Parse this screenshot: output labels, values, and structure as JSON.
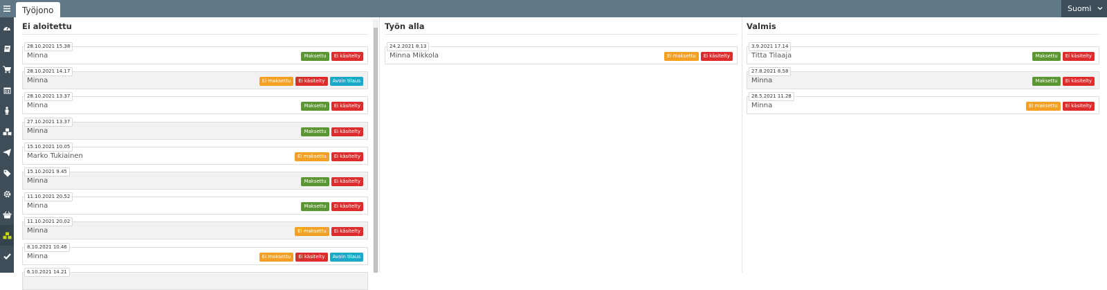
{
  "header": {
    "tab_label": "Työjono",
    "language": "Suomi"
  },
  "sidebar": {
    "items": [
      {
        "icon": "dashboard-icon"
      },
      {
        "icon": "book-icon"
      },
      {
        "icon": "cart-icon"
      },
      {
        "icon": "calendar-icon"
      },
      {
        "icon": "person-icon"
      },
      {
        "icon": "cubes-icon"
      },
      {
        "icon": "paper-plane-icon"
      },
      {
        "icon": "tag-icon"
      },
      {
        "icon": "gear-icon"
      },
      {
        "icon": "basket-icon"
      },
      {
        "icon": "cubes-active-icon",
        "active": true
      },
      {
        "icon": "check-icon"
      }
    ]
  },
  "colors": {
    "topbar": "#5f7989",
    "sidebar": "#3e4d57",
    "active_icon": "#c6d61a",
    "badge_green": "#5c9632",
    "badge_red": "#dd2c2c",
    "badge_orange": "#f4a024",
    "badge_cyan": "#1aa9c9"
  },
  "columns": [
    {
      "title": "Ei aloitettu",
      "cards": [
        {
          "date": "28.10.2021 15.38",
          "name": "Minna",
          "badges": [
            {
              "text": "Maksettu",
              "color": "green"
            },
            {
              "text": "Ei käsitelty",
              "color": "red"
            }
          ]
        },
        {
          "date": "28.10.2021 14.17",
          "name": "Minna",
          "badges": [
            {
              "text": "Ei maksettu",
              "color": "orange"
            },
            {
              "text": "Ei käsitelty",
              "color": "red"
            },
            {
              "text": "Avoin tilaus",
              "color": "cyan"
            }
          ]
        },
        {
          "date": "28.10.2021 13.37",
          "name": "Minna",
          "badges": [
            {
              "text": "Maksettu",
              "color": "green"
            },
            {
              "text": "Ei käsitelty",
              "color": "red"
            }
          ]
        },
        {
          "date": "27.10.2021 13.37",
          "name": "Minna",
          "badges": [
            {
              "text": "Maksettu",
              "color": "green"
            },
            {
              "text": "Ei käsitelty",
              "color": "red"
            }
          ]
        },
        {
          "date": "15.10.2021 10.05",
          "name": "Marko Tukiainen",
          "badges": [
            {
              "text": "Ei maksettu",
              "color": "orange"
            },
            {
              "text": "Ei käsitelty",
              "color": "red"
            }
          ]
        },
        {
          "date": "15.10.2021 9.45",
          "name": "Minna",
          "badges": [
            {
              "text": "Maksettu",
              "color": "green"
            },
            {
              "text": "Ei käsitelty",
              "color": "red"
            }
          ]
        },
        {
          "date": "11.10.2021 20.52",
          "name": "Minna",
          "badges": [
            {
              "text": "Maksettu",
              "color": "green"
            },
            {
              "text": "Ei käsitelty",
              "color": "red"
            }
          ]
        },
        {
          "date": "11.10.2021 20.02",
          "name": "Minna",
          "badges": [
            {
              "text": "Ei maksettu",
              "color": "orange"
            },
            {
              "text": "Ei käsitelty",
              "color": "red"
            }
          ]
        },
        {
          "date": "8.10.2021 10.46",
          "name": "Minna",
          "badges": [
            {
              "text": "Ei maksettu",
              "color": "orange"
            },
            {
              "text": "Ei käsitelty",
              "color": "red"
            },
            {
              "text": "Avoin tilaus",
              "color": "cyan"
            }
          ]
        },
        {
          "date": "6.10.2021 14.21",
          "name": "",
          "badges": []
        }
      ]
    },
    {
      "title": "Työn alla",
      "cards": [
        {
          "date": "24.2.2021 8.13",
          "name": "Minna Mikkola",
          "badges": [
            {
              "text": "Ei maksettu",
              "color": "orange"
            },
            {
              "text": "Ei käsitelty",
              "color": "red"
            }
          ]
        }
      ]
    },
    {
      "title": "Valmis",
      "cards": [
        {
          "date": "3.9.2021 17.14",
          "name": "Titta Tilaaja",
          "badges": [
            {
              "text": "Maksettu",
              "color": "green"
            },
            {
              "text": "Ei käsitelty",
              "color": "red"
            }
          ]
        },
        {
          "date": "27.8.2021 8.58",
          "name": "Minna",
          "badges": [
            {
              "text": "Maksettu",
              "color": "green"
            },
            {
              "text": "Ei käsitelty",
              "color": "red"
            }
          ]
        },
        {
          "date": "28.5.2021 11.28",
          "name": "Minna",
          "badges": [
            {
              "text": "Ei maksettu",
              "color": "orange"
            },
            {
              "text": "Ei käsitelty",
              "color": "red"
            }
          ]
        }
      ]
    }
  ]
}
